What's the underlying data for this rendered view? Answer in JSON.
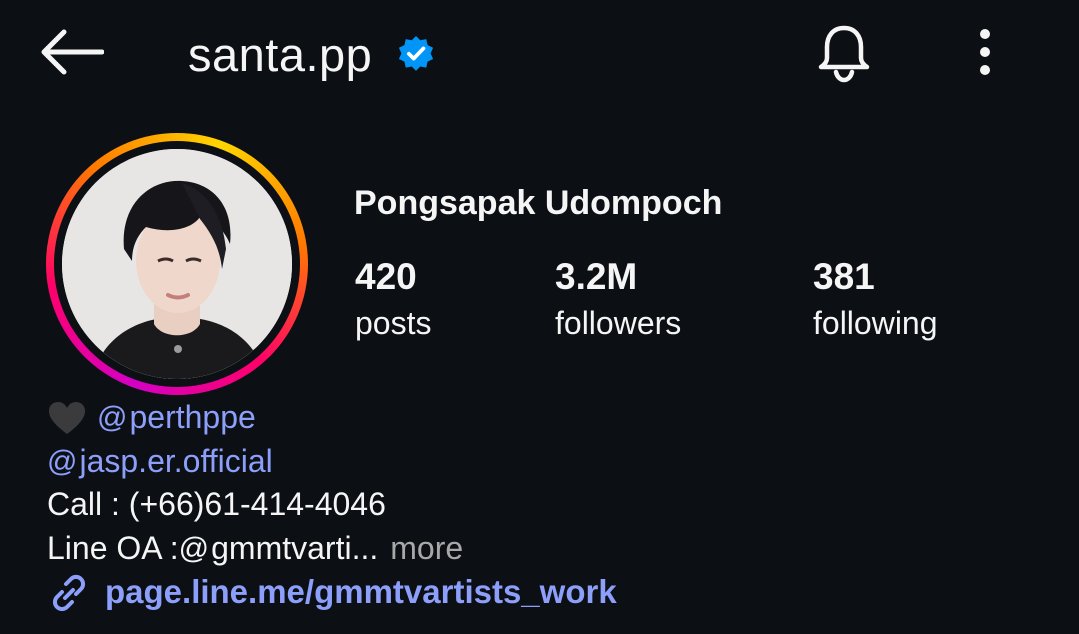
{
  "header": {
    "handle": "santa.pp",
    "icons": [
      "back-arrow-icon",
      "verified-badge-icon",
      "bell-icon",
      "more-vertical-icon"
    ]
  },
  "profile": {
    "full_name": "Pongsapak Udompoch",
    "stats": {
      "posts": {
        "value": "420",
        "label": "posts"
      },
      "followers": {
        "value": "3.2M",
        "label": "followers"
      },
      "following": {
        "value": "381",
        "label": "following"
      }
    }
  },
  "bio": {
    "heart_emoji": "🖤",
    "mention1": "perthppe",
    "mention2": "jasp.er.official",
    "threads_symbol": "@",
    "line3": "Call : (+66)61-414-4046",
    "line4_prefix": "Line OA : ",
    "line4_value": "gmmtvarti...",
    "more": "more",
    "link": "page.line.me/gmmtvartists_work"
  },
  "colors": {
    "background": "#0c1014",
    "text": "#f5f5f5",
    "link": "#8c9ffa",
    "muted": "#a8a8a8",
    "verified": "#0095f6"
  }
}
